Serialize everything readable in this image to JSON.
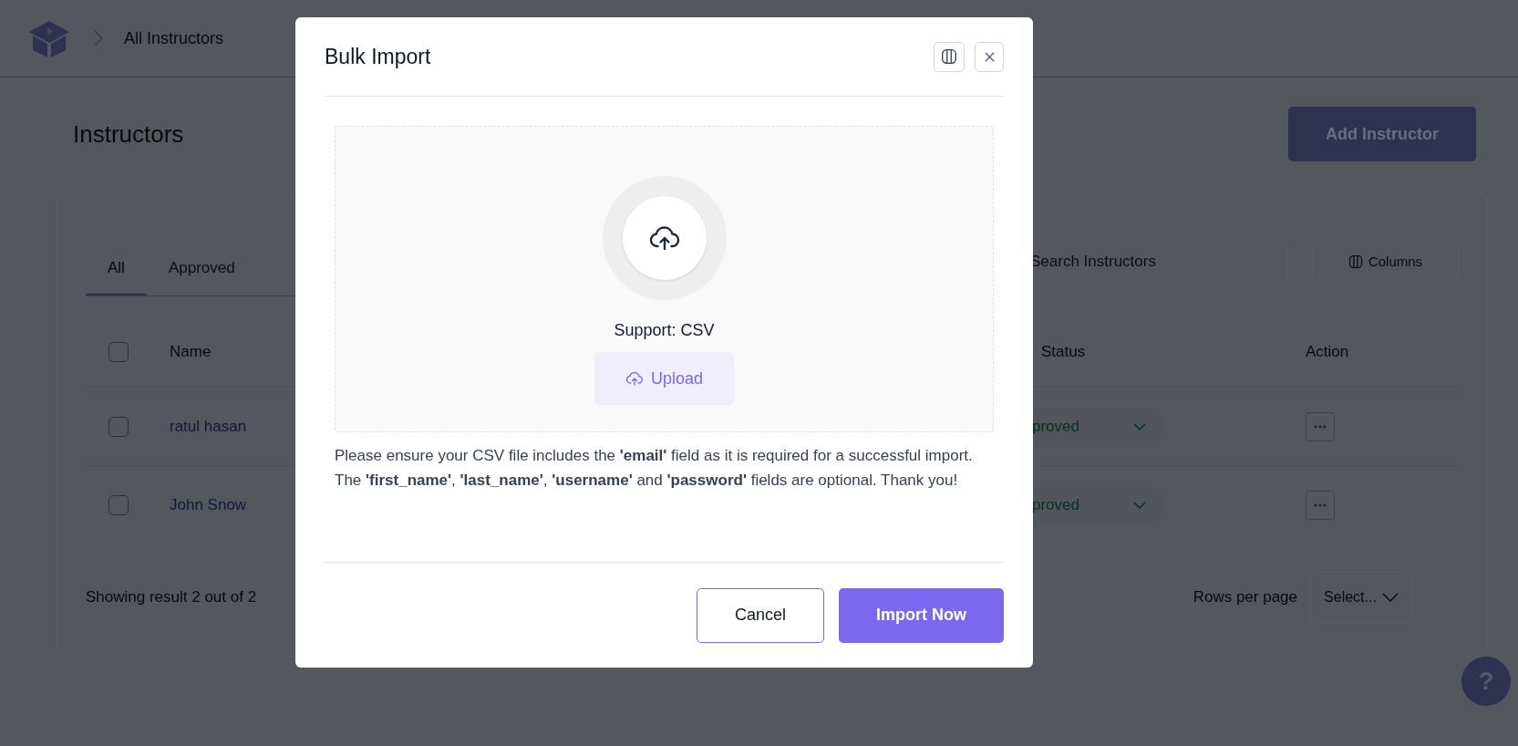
{
  "header": {
    "breadcrumb": "All Instructors"
  },
  "page": {
    "title": "Instructors",
    "add_button": "Add Instructor"
  },
  "tabs": [
    {
      "label": "All",
      "selected": true
    },
    {
      "label": "Approved",
      "selected": false
    }
  ],
  "search": {
    "placeholder": "Search Instructors"
  },
  "columns_button": "Columns",
  "table": {
    "header_checked": false,
    "columns": [
      "Name",
      "Status",
      "Action"
    ],
    "rows": [
      {
        "checked": false,
        "name": "ratul hasan",
        "status": "proved"
      },
      {
        "checked": false,
        "name": "John Snow",
        "status": "proved"
      }
    ]
  },
  "footer": {
    "summary": "Showing result 2 out of 2",
    "rows_per_page": "Rows per page",
    "select_placeholder": "Select..."
  },
  "help": "?",
  "modal": {
    "title": "Bulk Import",
    "support": "Support: CSV",
    "upload": "Upload",
    "note": "Please ensure your CSV file includes the **'email'** field as it is required for a successful import. The **'first_name'**, **'last_name'**, **'username'** and **'password'** fields are optional. Thank you!",
    "buttons": [
      {
        "label": "Cancel",
        "kind": "secondary"
      },
      {
        "label": "Import Now",
        "kind": "primary"
      }
    ]
  }
}
